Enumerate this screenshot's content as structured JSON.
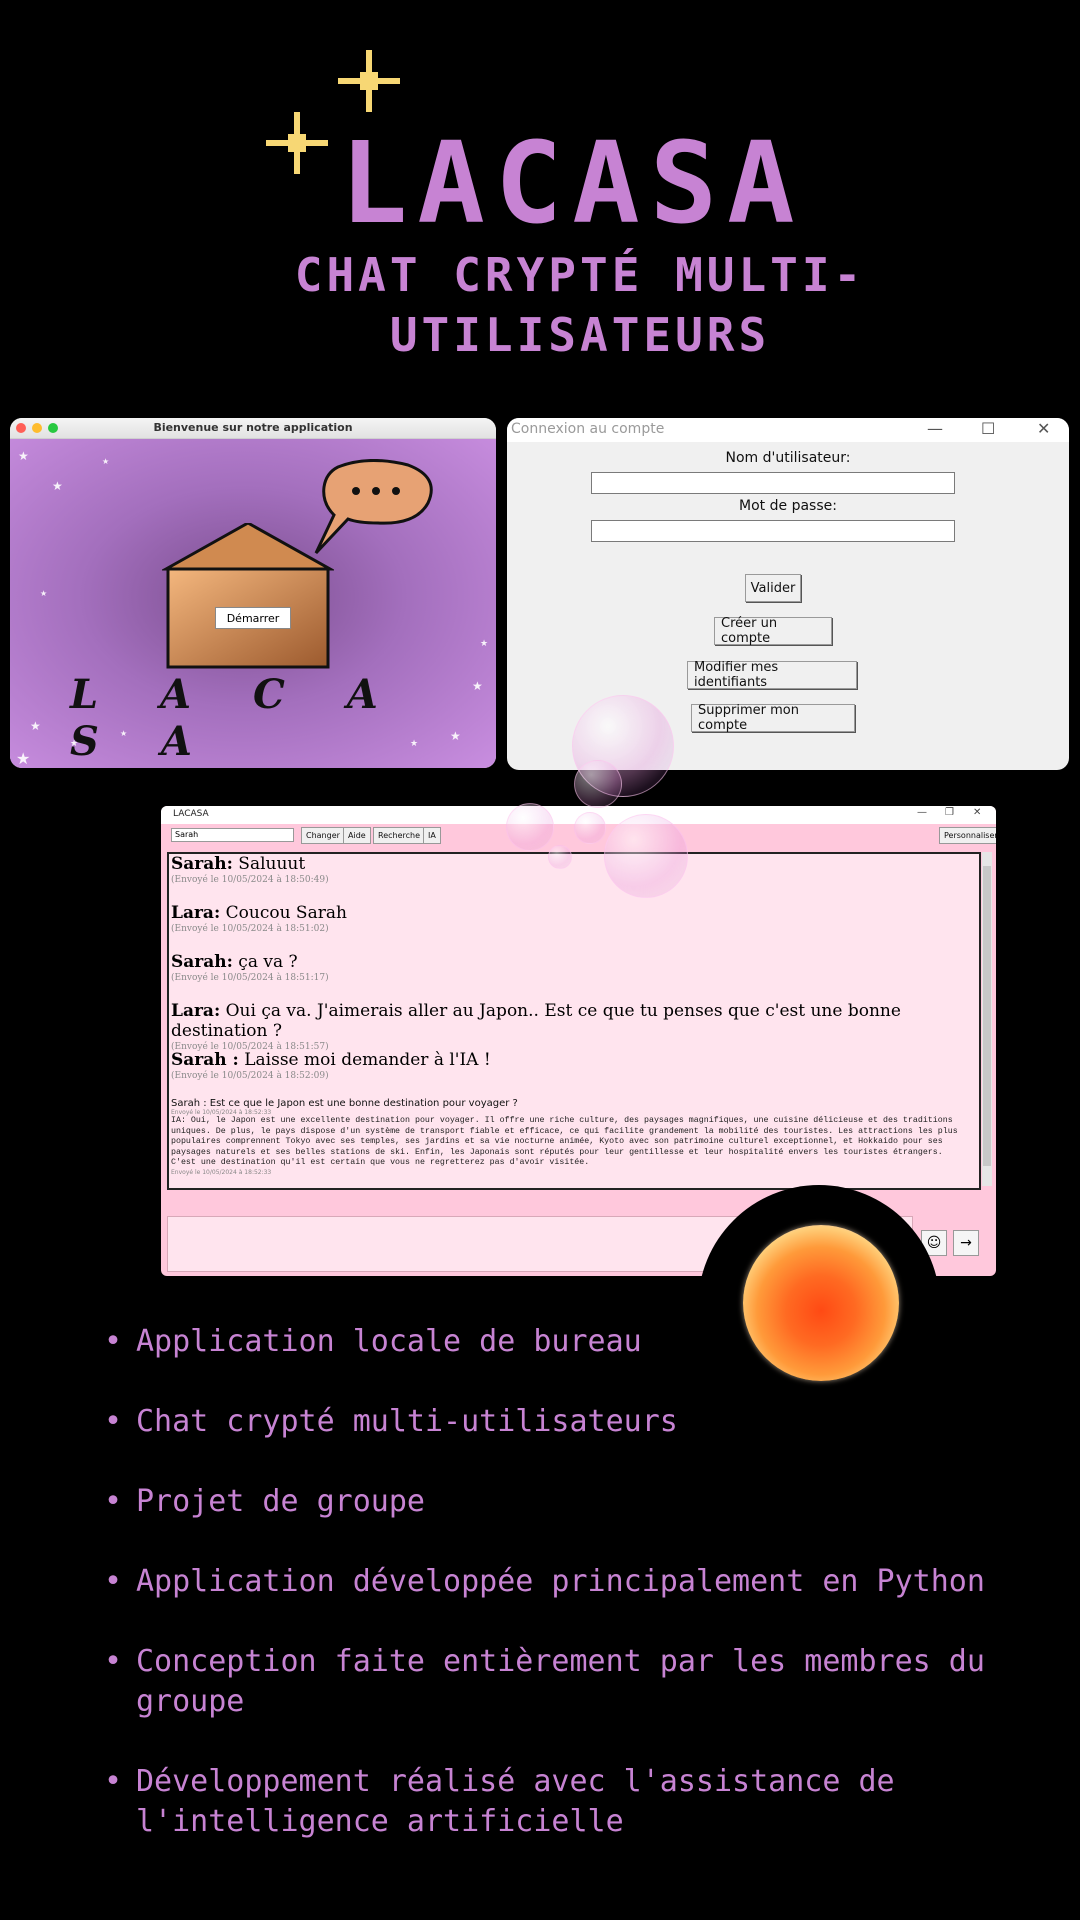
{
  "header": {
    "title": "LACASA",
    "subtitle": "Chat crypté multi-utilisateurs"
  },
  "welcome_window": {
    "title": "Bienvenue sur notre application",
    "start_button": "Démarrer",
    "logo_text": "L A C A S A"
  },
  "login_window": {
    "title": "Connexion au compte",
    "username_label": "Nom d'utilisateur:",
    "password_label": "Mot de passe:",
    "buttons": {
      "validate": "Valider",
      "create": "Créer un compte",
      "modify": "Modifier mes identifiants",
      "delete": "Supprimer mon compte"
    }
  },
  "chat_window": {
    "title": "LACASA",
    "username_value": "Sarah",
    "toolbar": {
      "change": "Changer",
      "help": "Aide",
      "search": "Recherche",
      "ia": "IA",
      "customize": "Personnaliser"
    },
    "messages": [
      {
        "author": "Sarah:",
        "text": " Saluuut",
        "timestamp": "(Envoyé le 10/05/2024 à 18:50:49)"
      },
      {
        "author": "Lara:",
        "text": " Coucou Sarah",
        "timestamp": "(Envoyé le 10/05/2024 à 18:51:02)"
      },
      {
        "author": "Sarah:",
        "text": " ça va ?",
        "timestamp": "(Envoyé le 10/05/2024 à 18:51:17)"
      },
      {
        "author": "Lara:",
        "text": " Oui ça va. J'aimerais aller au Japon.. Est ce que tu penses que c'est une bonne destination ?",
        "timestamp": "(Envoyé le 10/05/2024 à 18:51:57)"
      },
      {
        "author": "Sarah :",
        "text": " Laisse moi demander à l'IA !",
        "timestamp": "(Envoyé le 10/05/2024 à 18:52:09)"
      }
    ],
    "ia_question": "Sarah : Est ce que le Japon est une bonne destination pour voyager ?",
    "ia_question_timestamp": "Envoyé le 10/05/2024 à 18:52:33",
    "ia_answer": "IA:  Oui, le Japon est une excellente destination pour voyager. Il offre une riche culture, des paysages magnifiques, une cuisine délicieuse et des traditions uniques. De plus, le pays dispose d'un système de transport fiable et efficace, ce qui facilite grandement la mobilité des touristes. Les attractions les plus populaires comprennent Tokyo avec ses temples, ses jardins et sa vie nocturne animée, Kyoto avec son patrimoine culturel exceptionnel, et Hokkaido pour ses paysages naturels et ses belles stations de ski. Enfin, les Japonais sont réputés pour leur gentillesse et leur hospitalité envers les touristes étrangers. C'est une destination qu'il est certain que vous ne regretterez pas d'avoir visitée.",
    "ia_answer_timestamp": "Envoyé le 10/05/2024 à 18:52:33",
    "send_icon": "→",
    "emoji_icon": "☺"
  },
  "features": [
    "Application locale de bureau",
    "Chat crypté multi-utilisateurs",
    "Projet de groupe",
    "Application développée principalement en Python",
    "Conception faite entièrement par les membres du groupe",
    "Développement réalisé avec l'assistance de l'intelligence artificielle"
  ],
  "colors": {
    "accent": "#c783d3",
    "sparkle": "#f7d774",
    "chat_bg": "#ffc8dc"
  }
}
